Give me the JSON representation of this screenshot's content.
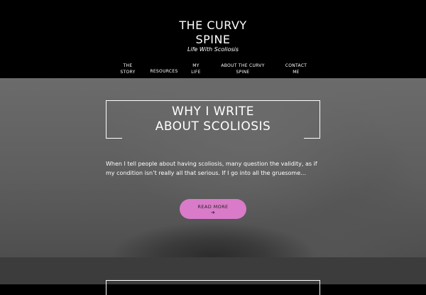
{
  "site": {
    "title_line1": "THE CURVY",
    "title_line2": "SPINE",
    "tagline": "Life With Scoliosis"
  },
  "nav": {
    "items": [
      {
        "line1": "THE",
        "line2": "STORY"
      },
      {
        "line1": "RESOURCES",
        "line2": ""
      },
      {
        "line1": "MY",
        "line2": "LIFE"
      },
      {
        "line1": "ABOUT THE CURVY",
        "line2": "SPINE"
      },
      {
        "line1": "CONTACT",
        "line2": "ME"
      }
    ]
  },
  "post": {
    "title_line1": "WHY I WRITE",
    "title_line2": "ABOUT SCOLIOSIS",
    "excerpt": "When I tell people about having scoliosis, many question the validity, as if my condition isn’t really all that serious. If I go into all the gruesome…",
    "read_more_label": "READ MORE",
    "read_more_arrow": "➔"
  },
  "colors": {
    "header_bg": "#000000",
    "accent_button": "#d97bc8",
    "text": "#ffffff"
  }
}
